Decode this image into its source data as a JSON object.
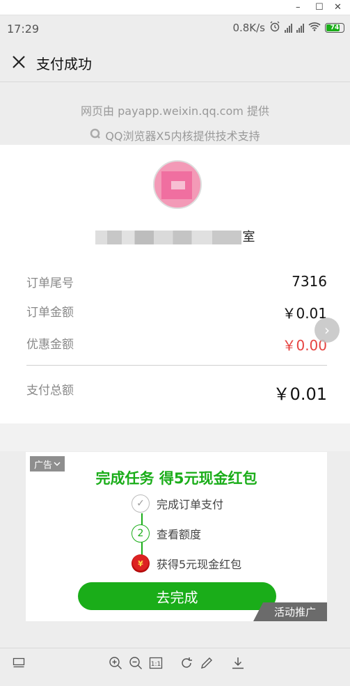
{
  "window": {
    "minimize": "–",
    "maximize": "☐",
    "close": "✕"
  },
  "status": {
    "time": "17:29",
    "speed": "0.8K/s",
    "battery": "74"
  },
  "nav": {
    "title": "支付成功"
  },
  "provider": {
    "line1": "网页由 payapp.weixin.qq.com 提供",
    "line2": "QQ浏览器X5内核提供技术支持"
  },
  "merchant": {
    "name_suffix": "室"
  },
  "order": {
    "rows": [
      {
        "label": "订单尾号",
        "value": "7316"
      },
      {
        "label": "订单金额",
        "value": "￥0.01"
      },
      {
        "label": "优惠金额",
        "value": "￥0.00"
      }
    ],
    "total": {
      "label": "支付总额",
      "value": "￥0.01"
    }
  },
  "ad": {
    "badge": "广告",
    "title": "完成任务  得5元现金红包",
    "steps": [
      {
        "num": "✓",
        "label": "完成订单支付"
      },
      {
        "num": "2",
        "label": "查看额度"
      },
      {
        "num": "¥",
        "label": "获得5元现金红包"
      }
    ],
    "cta": "去完成",
    "tag": "活动推广"
  },
  "colors": {
    "green": "#1aad19",
    "red": "#e64340"
  }
}
